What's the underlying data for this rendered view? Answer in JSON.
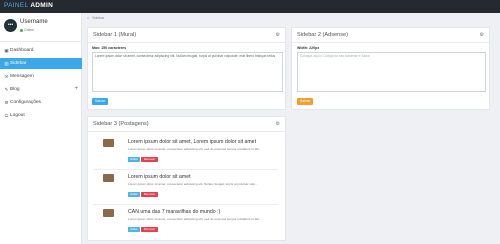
{
  "app": {
    "brand_part1": "PAINEL",
    "brand_part2": "ADMIN"
  },
  "profile": {
    "avatar_text": "•••",
    "username": "Username",
    "status": "Online"
  },
  "sidebar": {
    "items": [
      {
        "label": "Dashboard",
        "icon": "dashboard-icon",
        "glyph": "▣"
      },
      {
        "label": "Sidebar",
        "icon": "sidebar-icon",
        "glyph": "▥"
      },
      {
        "label": "Mensagem",
        "icon": "envelope-icon",
        "glyph": "✉"
      },
      {
        "label": "Blog",
        "icon": "pencil-icon",
        "glyph": "✎",
        "expand": "+"
      },
      {
        "label": "Configurações",
        "icon": "gear-icon",
        "glyph": "⚙"
      },
      {
        "label": "Logout",
        "icon": "power-icon",
        "glyph": "⏻"
      }
    ],
    "active_index": 1
  },
  "breadcrumb": {
    "home_glyph": "⌂",
    "current": "Sidebar"
  },
  "panel1": {
    "title": "Sidebar 1 (Mural)",
    "field_label": "Max: 150 caracteres",
    "textarea_value": "Lorem ipsum dolor sit amet, consectetur adipiscing elit. Nullam feugiat, turpis at pulvinar vulputate, erat libero tristique tellus",
    "button": "Salvar"
  },
  "panel2": {
    "title": "Sidebar 2 (Adsense)",
    "field_label": "Width: 220px",
    "textarea_placeholder": "Coloque aqui o Código do seu Adsense e Salve",
    "button": "Salvar"
  },
  "panel3": {
    "title": "Sidebar 3 (Postagens)",
    "posts": [
      {
        "title": "Lorem ipsum dolor sit amet, Lorem ipsum dolor sit amet",
        "excerpt": "Lorem ipsum dolor sit amet, consectetur adipiscing elit, sed do eiusmod tempor incididunt ut lab...",
        "edit": "Editar",
        "remove": "Remover"
      },
      {
        "title": "Lorem ipsum dolor sit amet",
        "excerpt": "Lorem ipsum dolor sit amet, consectetur adipiscing elit. Nullam feugiat, turpis at pulvinar vulp...",
        "edit": "Editar",
        "remove": "Remover"
      },
      {
        "title": "CAN uma das 7 maravilhas do mundo :)",
        "excerpt": "Lorem ipsum dolor sit amet, consectetur adipiscing elit, sed do eiusmod tempor incididunt ut lab...",
        "edit": "Editar",
        "remove": "Remover"
      }
    ]
  },
  "gear_glyph": "⚙",
  "colors": {
    "topbar": "#252a30",
    "accent": "#3ca8ec",
    "save_orange": "#f0a02e",
    "edit_blue": "#4db4e4",
    "remove_red": "#e0434f"
  }
}
